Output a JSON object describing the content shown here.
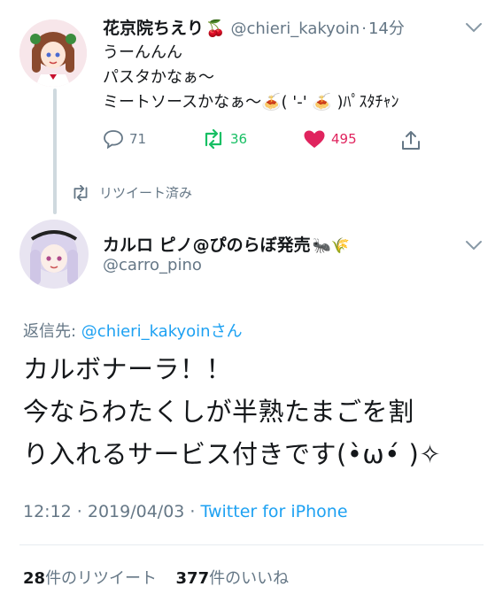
{
  "tweet1": {
    "display_name": "花京院ちえり",
    "name_emoji": "🍒",
    "handle": "@chieri_kakyoin",
    "separator": "·",
    "time": "14分",
    "lines": [
      "うーんんん",
      "パスタかなぁ〜",
      "ミートソースかなぁ〜🍝( '-' 🍝 )ﾊﾟｽﾀﾁｬﾝ"
    ],
    "reply_count": "71",
    "retweet_count": "36",
    "like_count": "495"
  },
  "retweet_notice": "リツイート済み",
  "tweet2": {
    "display_name": "カルロ ピノ@ぴのらぼ発売",
    "name_emoji": "🐜🌾",
    "handle": "@carro_pino",
    "reply_prefix": "返信先: ",
    "reply_handle": "@chieri_kakyoinさん",
    "lines": [
      "カルボナーラ！！",
      "今ならわたくしが半熟たまごを割",
      "り入れるサービス付きです(•̀ω•́ )✧"
    ],
    "time": "12:12 · 2019/04/03 · ",
    "client": "Twitter for iPhone",
    "retweets_num": "28",
    "retweets_label": "件のリツイート",
    "likes_num": "377",
    "likes_label": "件のいいね"
  },
  "colors": {
    "accent": "#1da1f2",
    "retweet": "#17bf63",
    "like": "#e0245e",
    "muted": "#657786"
  }
}
